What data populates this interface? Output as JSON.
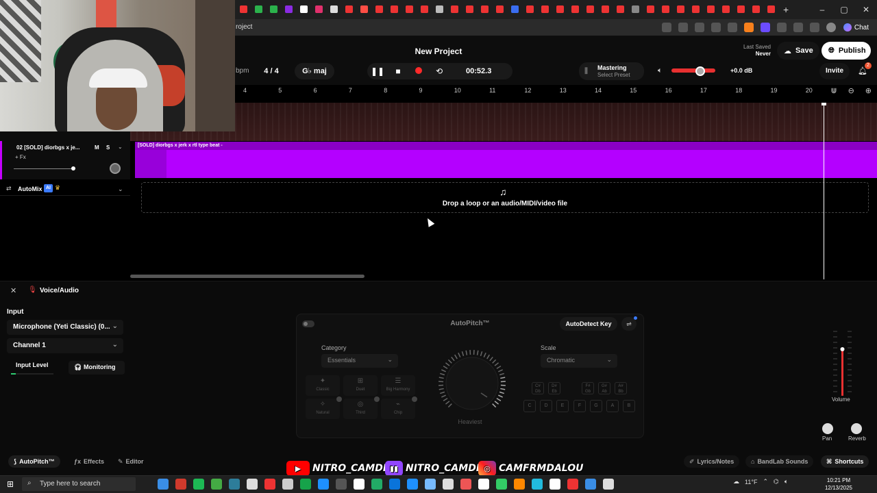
{
  "browser": {
    "tab_colors": [
      "#e33",
      "#2bb24c",
      "#2bb24c",
      "#8a2be2",
      "#fff",
      "#e1306c",
      "#ddd",
      "#e33",
      "#ff4e45",
      "#e33",
      "#e33",
      "#e33",
      "#e33",
      "#bbb",
      "#e33",
      "#e33",
      "#e33",
      "#e33",
      "#3a6df0",
      "#e33",
      "#e33",
      "#e33",
      "#e33",
      "#e33",
      "#e33",
      "#e33",
      "#888",
      "#e33",
      "#e33",
      "#e33",
      "#e33",
      "#e33",
      "#e33",
      "#e33",
      "#e33",
      "#e33"
    ],
    "url_fragment": "roject",
    "chat_label": "Chat",
    "window_controls": [
      "–",
      "▢",
      "✕"
    ],
    "new_tab": "+"
  },
  "header": {
    "project_title": "New Project",
    "last_saved_label": "Last Saved",
    "last_saved_value": "Never",
    "save_label": "Save",
    "publish_label": "Publish",
    "bpm_label": "bpm",
    "time_signature": "4 / 4",
    "key": "G♭ maj",
    "time": "00:52.3",
    "mastering_title": "Mastering",
    "mastering_preset": "Select Preset",
    "db_value": "+0.0 dB",
    "volume_level": 0.7,
    "invite_label": "Invite",
    "notification_count": "2"
  },
  "ruler": {
    "ticks": [
      "4",
      "5",
      "6",
      "7",
      "8",
      "9",
      "10",
      "11",
      "12",
      "13",
      "14",
      "15",
      "16",
      "17",
      "18",
      "19",
      "20"
    ]
  },
  "tracks": {
    "track2_name": "02  [SOLD] diorbgs x je...",
    "track2_fx": "+ Fx",
    "track2_mute": "M",
    "track2_solo": "S",
    "track2_clip_label": "[SOLD] diorbgs x jerk x rtl type beat -",
    "automix_label": "AutoMix",
    "ai_badge": "AI",
    "drop_text": "Drop a loop or an audio/MIDI/video file"
  },
  "panel": {
    "title": "Voice/Audio",
    "input_label": "Input",
    "input_device": "Microphone (Yeti Classic) (0...",
    "channel": "Channel 1",
    "input_level_label": "Input Level",
    "monitoring_label": "Monitoring"
  },
  "autopitch": {
    "title": "AutoPitch™",
    "autodetect_label": "AutoDetect Key",
    "category_label": "Category",
    "category_value": "Essentials",
    "scale_label": "Scale",
    "scale_value": "Chromatic",
    "styles": [
      "Classic",
      "Duet",
      "Big Harmony",
      "Natural",
      "Third",
      "Chip"
    ],
    "knob_label": "Heaviest",
    "accidental_keys": [
      [
        "C#",
        "Db"
      ],
      [
        "D#",
        "Eb"
      ],
      [
        "F#",
        "Gb"
      ],
      [
        "G#",
        "Ab"
      ],
      [
        "A#",
        "Bb"
      ]
    ],
    "natural_keys": [
      "C",
      "D",
      "E",
      "F",
      "G",
      "A",
      "B"
    ]
  },
  "mixer": {
    "volume_label": "Volume",
    "pan_label": "Pan",
    "reverb_label": "Reverb"
  },
  "bottom_tabs": {
    "autopitch": "AutoPitch™",
    "effects": "Effects",
    "editor": "Editor",
    "lyrics": "Lyrics/Notes",
    "bandlab": "BandLab Sounds",
    "shortcuts": "Shortcuts"
  },
  "overlay": {
    "youtube": "NITRO_CAMDEN",
    "twitch": "NITRO_CAMDEN",
    "instagram": "CAMFRMDALOU"
  },
  "taskbar": {
    "search_placeholder": "Type here to search",
    "weather": "11°F",
    "time": "10:21 PM",
    "date": "12/13/2025",
    "icon_colors": [
      "#3a8ee6",
      "#d03a2c",
      "#1db954",
      "#44aa44",
      "#2d7d9a",
      "#ddd",
      "#e33",
      "#ccc",
      "#16a34a",
      "#1e90ff",
      "#555",
      "#fff",
      "#2a6",
      "#0a74da",
      "#1e90ff",
      "#7bf",
      "#ddd",
      "#e55",
      "#fff",
      "#3c6",
      "#f80",
      "#2bd",
      "#fff",
      "#e33",
      "#3a8ee6",
      "#ddd"
    ]
  }
}
